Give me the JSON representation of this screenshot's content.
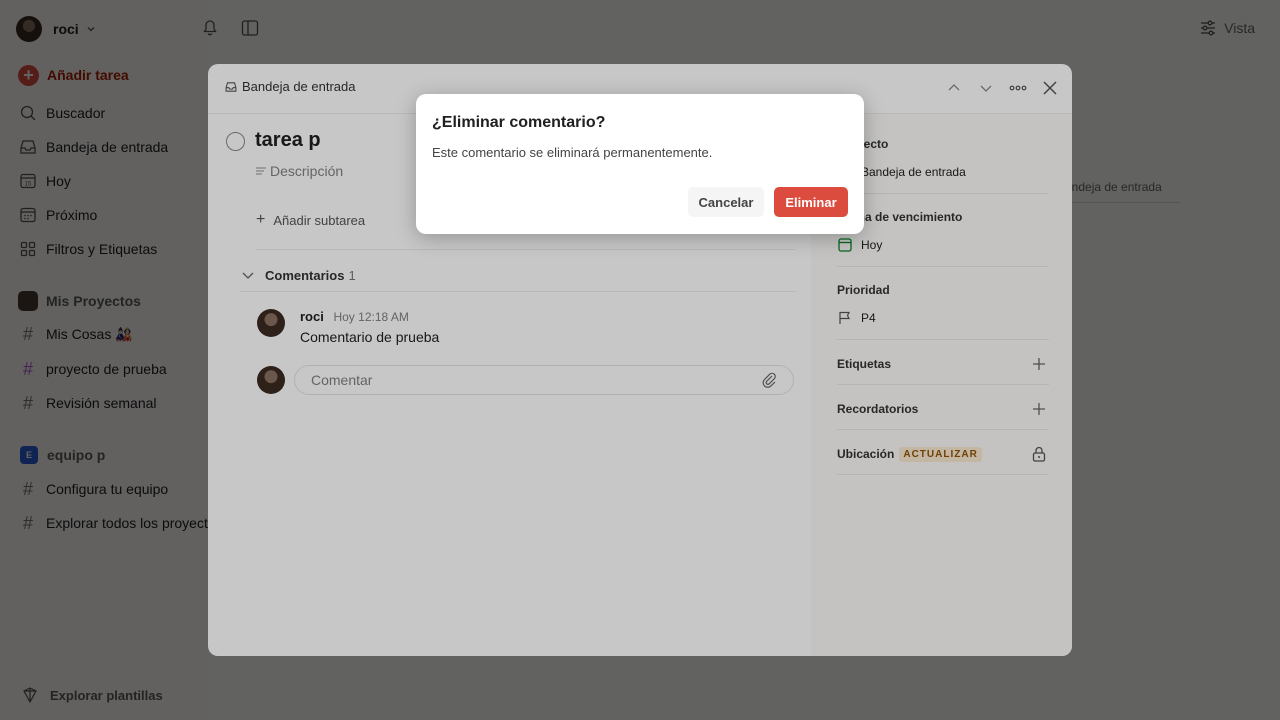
{
  "sidebar": {
    "user_name": "roci",
    "add_task_label": "Añadir tarea",
    "nav": [
      {
        "label": "Buscador",
        "icon": "search-icon"
      },
      {
        "label": "Bandeja de entrada",
        "icon": "inbox-icon"
      },
      {
        "label": "Hoy",
        "icon": "today-calendar-icon"
      },
      {
        "label": "Próximo",
        "icon": "upcoming-calendar-icon"
      },
      {
        "label": "Filtros y Etiquetas",
        "icon": "filters-grid-icon"
      }
    ],
    "my_projects_label": "Mis Proyectos",
    "projects": [
      {
        "label": "Mis Cosas 🎎",
        "color": "#808080"
      },
      {
        "label": "proyecto de prueba",
        "color": "#b05cd1"
      },
      {
        "label": "Revisión semanal",
        "color": "#808080"
      }
    ],
    "team_badge": "E",
    "team_label": "equipo p",
    "team_items": [
      {
        "label": "Configura tu equipo",
        "icon": "hash-icon"
      },
      {
        "label": "Explorar todos los proyectos",
        "icon": "search-project-icon"
      }
    ],
    "templates_label": "Explorar plantillas"
  },
  "top": {
    "view_label": "Vista",
    "bg_inbox_hint": "Bandeja de entrada"
  },
  "task": {
    "breadcrumb": "Bandeja de entrada",
    "title": "tarea p",
    "description_placeholder": "Descripción",
    "add_subtask_label": "Añadir subtarea",
    "comments_label": "Comentarios",
    "comments_count": "1",
    "comment": {
      "author": "roci",
      "time": "Hoy 12:18 AM",
      "text": "Comentario de prueba"
    },
    "comment_placeholder": "Comentar"
  },
  "side": {
    "project_label": "Proyecto",
    "project_value": "Bandeja de entrada",
    "due_label": "Fecha de vencimiento",
    "due_value": "Hoy",
    "priority_label": "Prioridad",
    "priority_value": "P4",
    "labels_label": "Etiquetas",
    "reminders_label": "Recordatorios",
    "location_label": "Ubicación",
    "upgrade_badge": "ACTUALIZAR"
  },
  "dialog": {
    "title": "¿Eliminar comentario?",
    "message": "Este comentario se eliminará permanentemente.",
    "cancel_label": "Cancelar",
    "delete_label": "Eliminar"
  },
  "colors": {
    "accent": "#dc4c3e",
    "overlay": "rgba(0,0,0,0.5)"
  }
}
